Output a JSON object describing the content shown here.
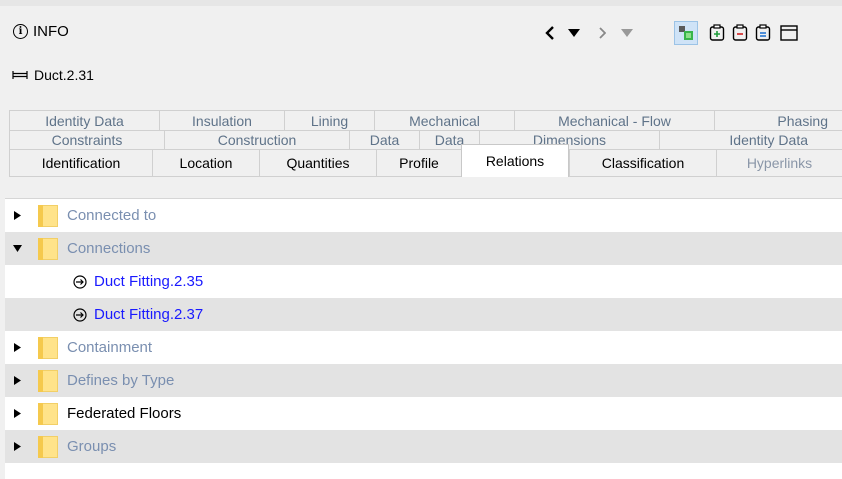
{
  "header": {
    "title": "INFO",
    "info_icon_glyph": "i",
    "toolbar": [
      {
        "name": "back-icon"
      },
      {
        "name": "history-dropdown-icon"
      },
      {
        "name": "forward-icon"
      },
      {
        "name": "forward-dropdown-icon"
      },
      {
        "name": "select-in-model-icon"
      },
      {
        "name": "expand-all-icon"
      },
      {
        "name": "collapse-all-icon"
      },
      {
        "name": "show-all-icon"
      },
      {
        "name": "window-toggle-icon"
      }
    ]
  },
  "element": {
    "name": "Duct.2.31",
    "icon": "duct-icon"
  },
  "tabs": {
    "row1": [
      "Identity Data",
      "Insulation",
      "Lining",
      "Mechanical",
      "Mechanical - Flow",
      "Phasing"
    ],
    "row2": [
      "Constraints",
      "Construction",
      "Data",
      "Data",
      "Dimensions",
      "Identity Data"
    ],
    "row3": [
      "Identification",
      "Location",
      "Quantities",
      "Profile",
      "Relations",
      "Classification",
      "Hyperlinks"
    ],
    "selected": "Relations"
  },
  "tree": {
    "items": [
      {
        "label": "Connected to",
        "expanded": false
      },
      {
        "label": "Connections",
        "expanded": true
      },
      {
        "label": "Duct Fitting.2.35",
        "child": true
      },
      {
        "label": "Duct Fitting.2.37",
        "child": true
      },
      {
        "label": "Containment",
        "expanded": false
      },
      {
        "label": "Defines by Type",
        "expanded": false
      },
      {
        "label": "Federated Floors",
        "expanded": false
      },
      {
        "label": "Groups",
        "expanded": false
      }
    ]
  },
  "colors": {
    "link": "#1a1aff",
    "muted_label": "#7a8fb0",
    "folder": "#ffe38a",
    "alt_row": "#e3e3e3"
  }
}
